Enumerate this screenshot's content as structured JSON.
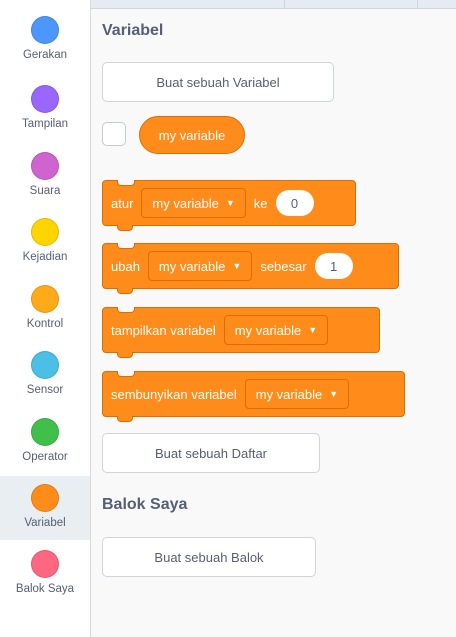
{
  "sidebar": {
    "categories": [
      {
        "label": "Gerakan",
        "color": "#4c97ff"
      },
      {
        "label": "Tampilan",
        "color": "#9966ff"
      },
      {
        "label": "Suara",
        "color": "#cf63cf"
      },
      {
        "label": "Kejadian",
        "color": "#ffd500"
      },
      {
        "label": "Kontrol",
        "color": "#ffab19"
      },
      {
        "label": "Sensor",
        "color": "#4cbfe6"
      },
      {
        "label": "Operator",
        "color": "#40bf4a"
      },
      {
        "label": "Variabel",
        "color": "#ff8c1a"
      },
      {
        "label": "Balok Saya",
        "color": "#ff6680"
      }
    ],
    "selected": "Variabel"
  },
  "palette": {
    "variables_heading": "Variabel",
    "make_variable_button": "Buat sebuah Variabel",
    "reporter_label": "my variable",
    "set_block": {
      "word": "atur",
      "dropdown": "my variable",
      "word2": "ke",
      "value": "0"
    },
    "change_block": {
      "word": "ubah",
      "dropdown": "my variable",
      "word2": "sebesar",
      "value": "1"
    },
    "show_block": {
      "word": "tampilkan variabel",
      "dropdown": "my variable"
    },
    "hide_block": {
      "word": "sembunyikan variabel",
      "dropdown": "my variable"
    },
    "make_list_button": "Buat sebuah Daftar",
    "my_blocks_heading": "Balok Saya",
    "make_block_button": "Buat sebuah Balok"
  },
  "colors": {
    "variables_block": "#ff8c1a",
    "variables_block_border": "#db6e00",
    "text_muted": "#575e75"
  }
}
